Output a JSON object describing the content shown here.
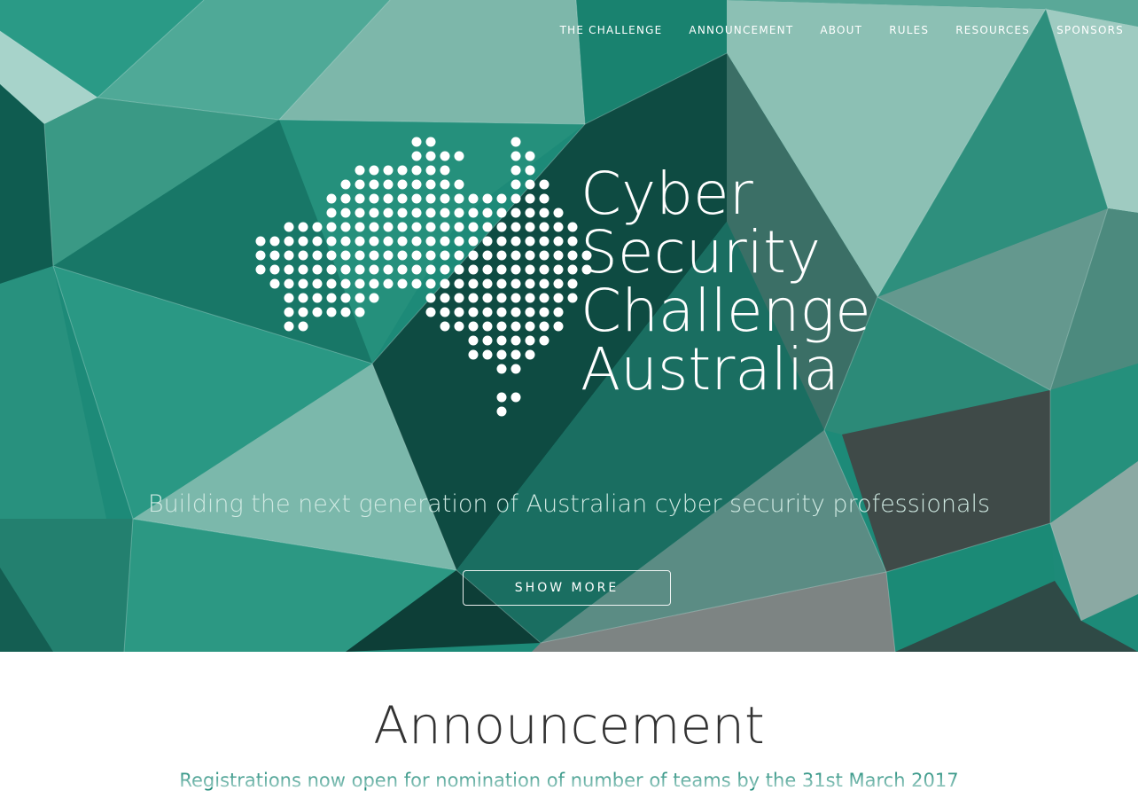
{
  "nav": {
    "items": [
      "THE CHALLENGE",
      "ANNOUNCEMENT",
      "ABOUT",
      "RULES",
      "RESOURCES",
      "SPONSORS"
    ]
  },
  "hero": {
    "title_lines": [
      "Cyber",
      "Security",
      "Challenge",
      "Australia"
    ],
    "tagline": "Building the next generation of Australian cyber security professionals",
    "button_label": "SHOW MORE"
  },
  "announcement": {
    "heading": "Announcement",
    "text": "Registrations now open for nomination of number of teams by the 31st March 2017"
  },
  "colors": {
    "accent": "#1d8a78",
    "hero_base": "#1d8a78",
    "text_dark": "#333333",
    "white": "#ffffff"
  },
  "icons": {
    "logo": "australia-dot-map-icon"
  }
}
